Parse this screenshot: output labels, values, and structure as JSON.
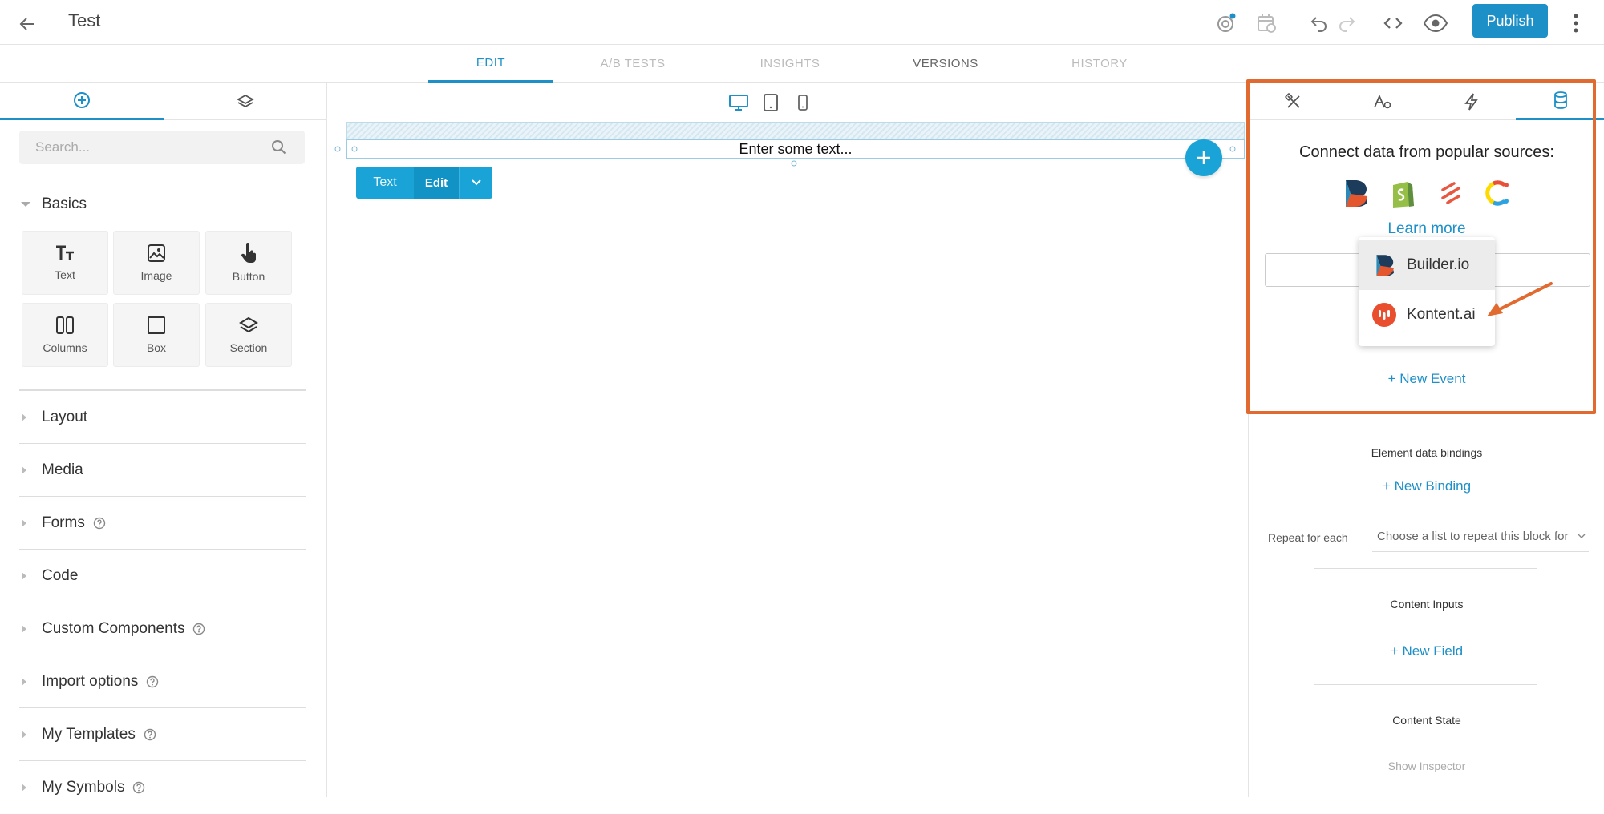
{
  "header": {
    "title": "Test",
    "publish_label": "Publish"
  },
  "main_tabs": [
    {
      "label": "EDIT",
      "state": "active"
    },
    {
      "label": "A/B TESTS",
      "state": "disabled"
    },
    {
      "label": "INSIGHTS",
      "state": "disabled"
    },
    {
      "label": "VERSIONS",
      "state": "normal"
    },
    {
      "label": "HISTORY",
      "state": "disabled"
    }
  ],
  "left_panel": {
    "search_placeholder": "Search...",
    "basics_title": "Basics",
    "blocks": [
      {
        "label": "Text",
        "icon": "text-icon"
      },
      {
        "label": "Image",
        "icon": "image-icon"
      },
      {
        "label": "Button",
        "icon": "hand-pointer-icon"
      },
      {
        "label": "Columns",
        "icon": "columns-icon"
      },
      {
        "label": "Box",
        "icon": "box-icon"
      },
      {
        "label": "Section",
        "icon": "layers-icon"
      }
    ],
    "sections": [
      {
        "label": "Layout",
        "help": false
      },
      {
        "label": "Media",
        "help": false
      },
      {
        "label": "Forms",
        "help": true
      },
      {
        "label": "Code",
        "help": false
      },
      {
        "label": "Custom Components",
        "help": true
      },
      {
        "label": "Import options",
        "help": true
      },
      {
        "label": "My Templates",
        "help": true
      },
      {
        "label": "My Symbols",
        "help": true
      }
    ]
  },
  "canvas": {
    "placeholder_text": "Enter some text...",
    "toolbar": {
      "text_label": "Text",
      "edit_label": "Edit"
    }
  },
  "right_panel": {
    "connect_title": "Connect data from popular sources:",
    "learn_more": "Learn more",
    "dropdown_items": [
      {
        "label": "Builder.io",
        "icon": "builder-io-logo"
      },
      {
        "label": "Kontent.ai",
        "icon": "kontent-ai-logo"
      }
    ],
    "new_event": "+ New Event",
    "element_bindings_title": "Element data bindings",
    "new_binding": "+ New Binding",
    "repeat_label": "Repeat for each",
    "repeat_placeholder": "Choose a list to repeat this block for",
    "content_inputs_title": "Content Inputs",
    "new_field": "+ New Field",
    "content_state_title": "Content State",
    "show_inspector": "Show Inspector"
  },
  "colors": {
    "accent": "#1e90c8",
    "highlight": "#e06a2f"
  }
}
